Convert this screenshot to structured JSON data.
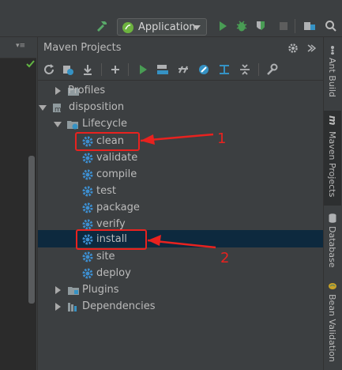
{
  "toolbar": {
    "run_config_label": "Application",
    "colors": {
      "run": "#4caf50",
      "debug": "#55b45e",
      "stop": "#6e6e6e",
      "build": "#4c8c2a"
    }
  },
  "editor": {
    "gutter_marks": [
      "▾≡"
    ]
  },
  "panel": {
    "title": "Maven Projects",
    "toolbar_icons": [
      "refresh-icon",
      "reimport-icon",
      "download-icon",
      "add-icon",
      "run-icon",
      "execute-goal-icon",
      "toggle-offline-icon",
      "skip-tests-icon",
      "show-dependencies-icon",
      "collapse-all-icon",
      "settings-wrench-icon"
    ]
  },
  "tree": {
    "profiles": "Profiles",
    "project": "disposition",
    "lifecycle": "Lifecycle",
    "goals": [
      "clean",
      "validate",
      "compile",
      "test",
      "package",
      "verify",
      "install",
      "site",
      "deploy"
    ],
    "plugins": "Plugins",
    "dependencies": "Dependencies"
  },
  "right_tabs": {
    "ant_build": "Ant Build",
    "maven_projects": "Maven Projects",
    "database": "Database",
    "bean_validation": "Bean Validation"
  },
  "annotations": {
    "label_1": "1",
    "label_2": "2",
    "color": "#e8221f"
  }
}
